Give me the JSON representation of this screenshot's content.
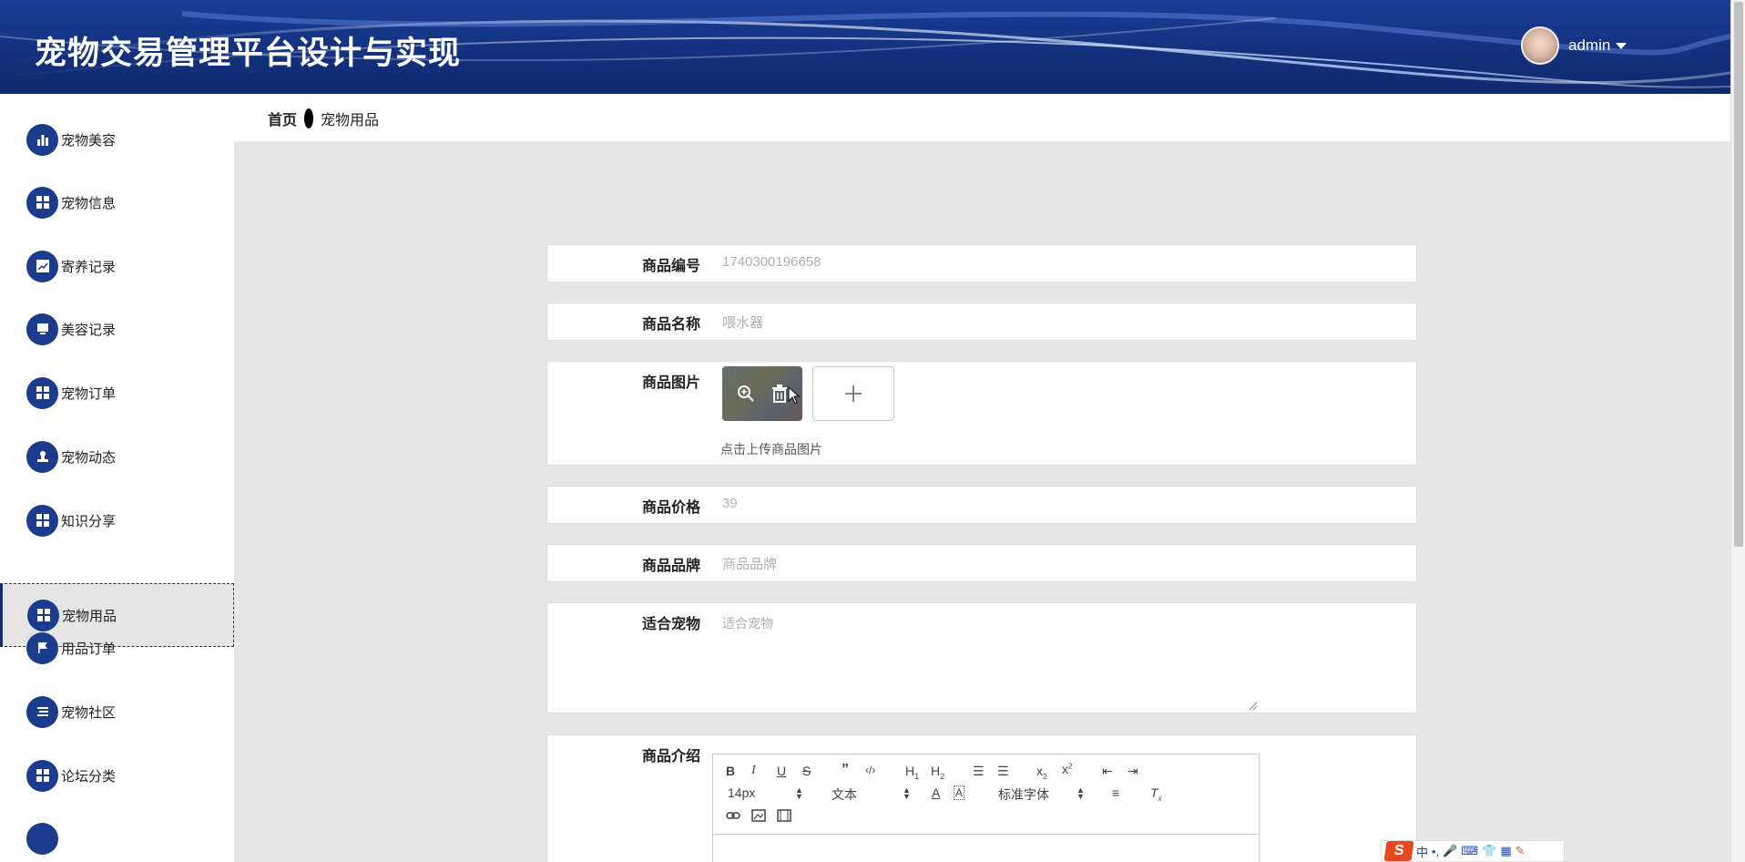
{
  "header": {
    "title": "宠物交易管理平台设计与实现",
    "username": "admin"
  },
  "breadcrumb": {
    "home": "首页",
    "current": "宠物用品"
  },
  "sidebar": {
    "items": [
      {
        "label": "宠物美容",
        "icon": "bar-chart-icon"
      },
      {
        "label": "宠物信息",
        "icon": "grid-icon"
      },
      {
        "label": "寄养记录",
        "icon": "trend-chart-icon"
      },
      {
        "label": "美容记录",
        "icon": "monitor-icon"
      },
      {
        "label": "宠物订单",
        "icon": "grid-icon"
      },
      {
        "label": "宠物动态",
        "icon": "stamp-icon"
      },
      {
        "label": "知识分享",
        "icon": "grid-icon"
      },
      {
        "label": "宠物用品",
        "icon": "grid-icon",
        "active": true
      },
      {
        "label": "用品订单",
        "icon": "flag-icon"
      },
      {
        "label": "宠物社区",
        "icon": "list-icon"
      },
      {
        "label": "论坛分类",
        "icon": "grid-icon"
      }
    ]
  },
  "form": {
    "code": {
      "label": "商品编号",
      "value": "1740300196658"
    },
    "name": {
      "label": "商品名称",
      "value": "喂水器"
    },
    "image": {
      "label": "商品图片",
      "hint": "点击上传商品图片"
    },
    "price": {
      "label": "商品价格",
      "value": "39"
    },
    "brand": {
      "label": "商品品牌",
      "placeholder": "商品品牌"
    },
    "suitable": {
      "label": "适合宠物",
      "placeholder": "适合宠物"
    },
    "intro": {
      "label": "商品介绍"
    }
  },
  "editor": {
    "font_size": "14px",
    "header_select": "文本",
    "font_family": "标准字体"
  },
  "ime": {
    "lang": "中"
  },
  "colors": {
    "header_bg": "#13317e",
    "sidebar_icon_bg": "#1b3c8c",
    "page_bg": "#e6e6e6"
  }
}
